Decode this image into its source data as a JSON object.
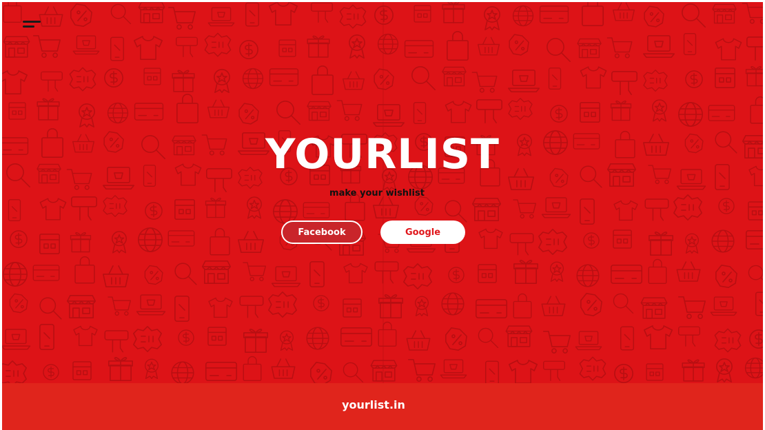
{
  "colors": {
    "brand_red": "#dd1317",
    "footer_red": "#e0251c",
    "pattern_stroke": "#b80f12",
    "text_dark": "#111111",
    "white": "#ffffff"
  },
  "header": {
    "menu_icon": "hamburger-icon"
  },
  "hero": {
    "title": "YOURLIST",
    "tagline": "make your wishlist",
    "pattern_icons": [
      "shopping-bag-icon",
      "shopping-cart-icon",
      "sale-tag-icon",
      "globe-icon",
      "magnifier-icon",
      "t-shirt-icon",
      "gift-icon",
      "basket-icon",
      "laptop-icon",
      "coin-icon",
      "credit-card-icon",
      "storefront-icon",
      "buy-sign-icon",
      "award-icon",
      "percent-icon",
      "smartphone-icon",
      "store-icon"
    ]
  },
  "buttons": {
    "facebook": "Facebook",
    "google": "Google"
  },
  "footer": {
    "site": "yourlist.in"
  }
}
